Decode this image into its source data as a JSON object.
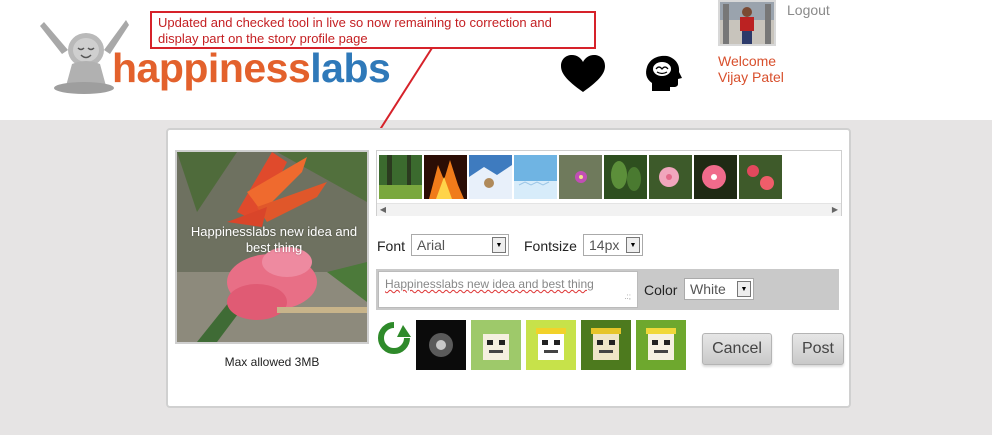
{
  "header": {
    "logo": {
      "part1": "happiness",
      "part2": "labs"
    },
    "annotation": "Updated and checked tool in live so now remaining to correction and display part on the story profile page",
    "user": {
      "logout_label": "Logout",
      "welcome_label": "Welcome",
      "name": "Vijay Patel"
    },
    "icons": [
      "heart-icon",
      "head-icon"
    ]
  },
  "editor": {
    "preview_caption": "Happinesslabs new idea and best thing",
    "max_size_label": "Max allowed 3MB",
    "font_label": "Font",
    "font_value": "Arial",
    "fontsize_label": "Fontsize",
    "fontsize_value": "14px",
    "text_value": "Happinesslabs new idea and best thing",
    "color_label": "Color",
    "color_value": "White",
    "cancel_label": "Cancel",
    "post_label": "Post"
  },
  "colors": {
    "accent_orange": "#e3612c",
    "accent_blue": "#2f79b9",
    "annotation_red": "#d6222a",
    "welcome": "#d84f2c"
  }
}
